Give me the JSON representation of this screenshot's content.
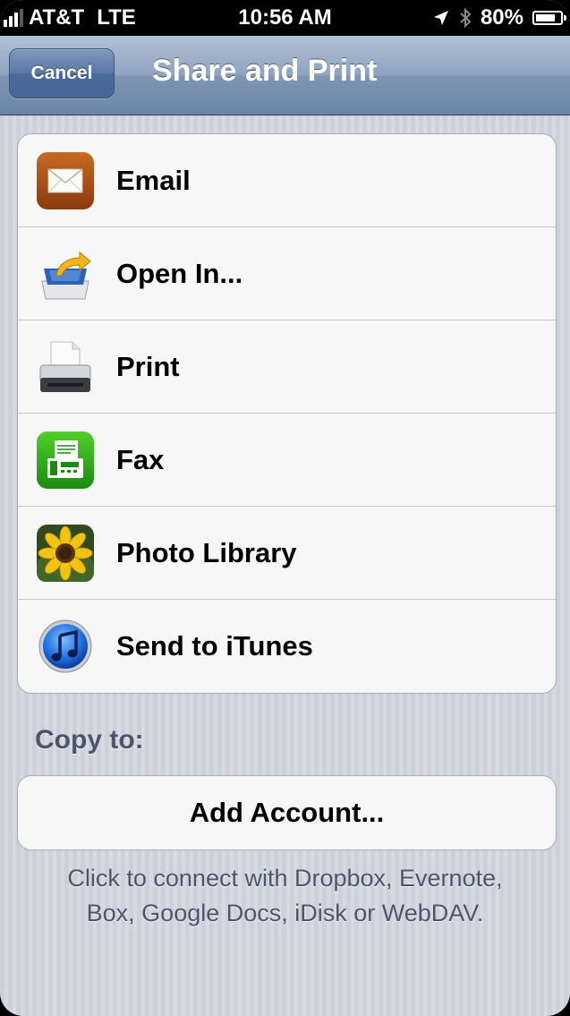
{
  "status_bar": {
    "carrier": "AT&T",
    "network": "LTE",
    "time": "10:56 AM",
    "battery": "80%",
    "battery_level": 0.8
  },
  "nav": {
    "cancel_label": "Cancel",
    "title": "Share and Print"
  },
  "share_items": [
    {
      "label": "Email",
      "icon": "mail-envelope-icon"
    },
    {
      "label": "Open In...",
      "icon": "open-in-tray-icon"
    },
    {
      "label": "Print",
      "icon": "printer-icon"
    },
    {
      "label": "Fax",
      "icon": "fax-machine-icon"
    },
    {
      "label": "Photo Library",
      "icon": "sunflower-photo-icon"
    },
    {
      "label": "Send to iTunes",
      "icon": "itunes-note-icon"
    }
  ],
  "copy_section": {
    "title": "Copy to:",
    "add_account_label": "Add Account...",
    "hint_line1": "Click to connect with Dropbox, Evernote,",
    "hint_line2": "Box, Google Docs, iDisk or WebDAV."
  },
  "colors": {
    "nav_bar": "#8ea3bf",
    "cancel_button": "#5a78a4",
    "background_stripes": "#d6dae2",
    "section_text": "#4c566a"
  }
}
